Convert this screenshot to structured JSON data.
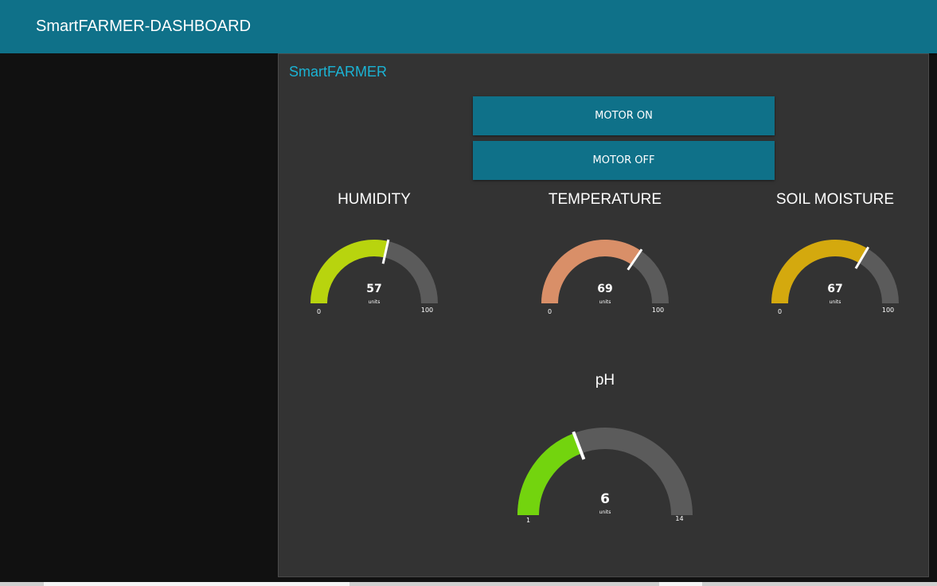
{
  "header": {
    "title": "SmartFARMER-DASHBOARD"
  },
  "group": {
    "title": "SmartFARMER"
  },
  "buttons": {
    "motor_on": "MOTOR ON",
    "motor_off": "MOTOR OFF"
  },
  "gauges": [
    {
      "id": "humidity",
      "label": "HUMIDITY",
      "value": 57,
      "min": 0,
      "max": 100,
      "units": "units",
      "color": "#b8d40e"
    },
    {
      "id": "temperature",
      "label": "TEMPERATURE",
      "value": 69,
      "min": 0,
      "max": 100,
      "units": "units",
      "color": "#d98f68"
    },
    {
      "id": "soil-moisture",
      "label": "SOIL MOISTURE",
      "value": 67,
      "min": 0,
      "max": 100,
      "units": "units",
      "color": "#d4a90e"
    },
    {
      "id": "ph",
      "label": "pH",
      "value": 6,
      "min": 1,
      "max": 14,
      "units": "units",
      "color": "#73d40e"
    }
  ],
  "colors": {
    "header_bg": "#0f7189",
    "accent": "#1bb3d4",
    "panel_bg": "#333333",
    "gauge_track": "#5b5b5b"
  }
}
